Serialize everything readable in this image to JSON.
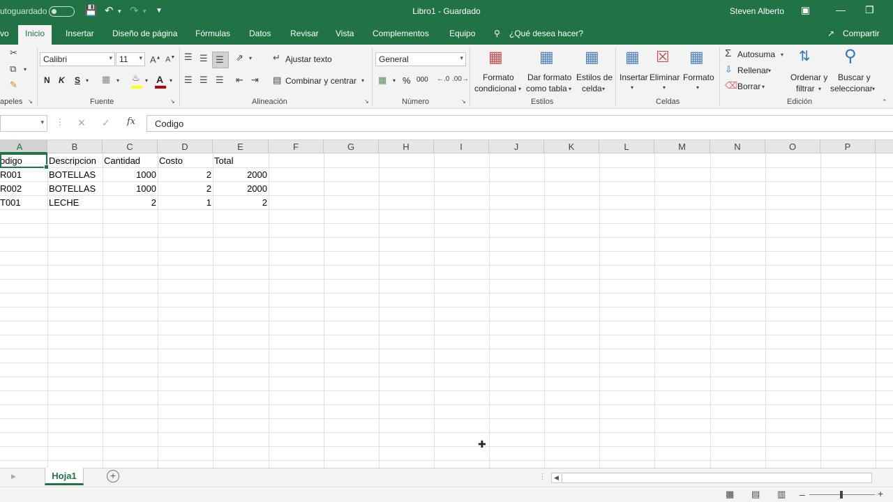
{
  "titlebar": {
    "autosave_label": "utoguardado",
    "doc_title": "Libro1  -  Guardado",
    "user": "Steven Alberto",
    "colors": {
      "brand": "#217346"
    }
  },
  "tabs": [
    "vo",
    "Inicio",
    "Insertar",
    "Diseño de página",
    "Fórmulas",
    "Datos",
    "Revisar",
    "Vista",
    "Complementos",
    "Equipo"
  ],
  "active_tab": "Inicio",
  "tell_me": "¿Qué desea hacer?",
  "share": "Compartir",
  "ribbon": {
    "clipboard_label": "apeles",
    "font": {
      "name": "Calibri",
      "size": "11",
      "group_label": "Fuente",
      "bold": "N",
      "italic": "K",
      "underline": "S"
    },
    "alignment": {
      "wrap": "Ajustar texto",
      "merge": "Combinar y centrar",
      "group_label": "Alineación"
    },
    "number": {
      "format": "General",
      "group_label": "Número",
      "percent": "%",
      "thousands": "000"
    },
    "styles": {
      "conditional_1": "Formato",
      "conditional_2": "condicional",
      "table_1": "Dar formato",
      "table_2": "como tabla",
      "cell_1": "Estilos de",
      "cell_2": "celda",
      "group_label": "Estilos"
    },
    "cells": {
      "insert": "Insertar",
      "delete": "Eliminar",
      "format": "Formato",
      "group_label": "Celdas"
    },
    "editing": {
      "autosum": "Autosuma",
      "fill": "Rellenar",
      "clear": "Borrar",
      "sort_1": "Ordenar y",
      "sort_2": "filtrar",
      "find_1": "Buscar y",
      "find_2": "seleccionar",
      "group_label": "Edición"
    }
  },
  "formula_bar": {
    "fx": "fx",
    "value": "Codigo"
  },
  "columns": [
    "A",
    "B",
    "C",
    "D",
    "E",
    "F",
    "G",
    "H",
    "I",
    "J",
    "K",
    "L",
    "M",
    "N",
    "O",
    "P"
  ],
  "rows": [
    [
      "odigo",
      "Descripcion",
      "Cantidad",
      "Costo",
      "Total"
    ],
    [
      "R001",
      "BOTELLAS",
      "1000",
      "2",
      "2000"
    ],
    [
      "R002",
      "BOTELLAS",
      "1000",
      "2",
      "2000"
    ],
    [
      "T001",
      "LECHE",
      "2",
      "1",
      "2"
    ]
  ],
  "sheet_tab": "Hoja1"
}
